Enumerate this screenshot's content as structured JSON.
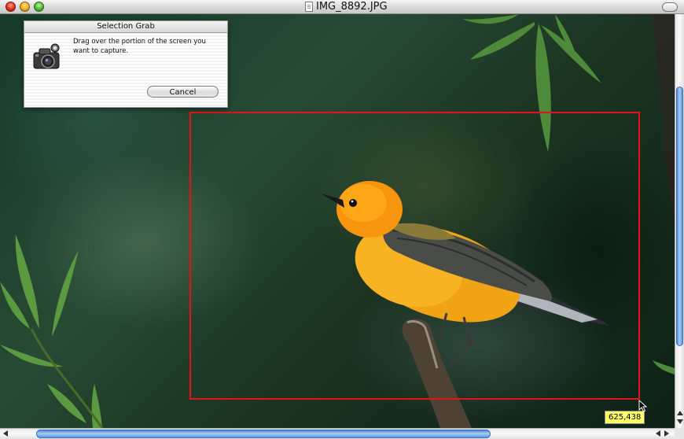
{
  "window": {
    "title": "IMG_8892.JPG"
  },
  "dialog": {
    "title": "Selection Grab",
    "message": "Drag over the portion of the screen you want to capture.",
    "cancel_label": "Cancel"
  },
  "selection": {
    "coordinates_readout": "625,438"
  },
  "colors": {
    "selection_border": "#e0141a",
    "coord_tag_background": "#ffff6a",
    "scroll_thumb": "#5a96e0"
  },
  "icons": {
    "dialog_icon": "camera-icon",
    "document_proxy": "document-icon"
  }
}
